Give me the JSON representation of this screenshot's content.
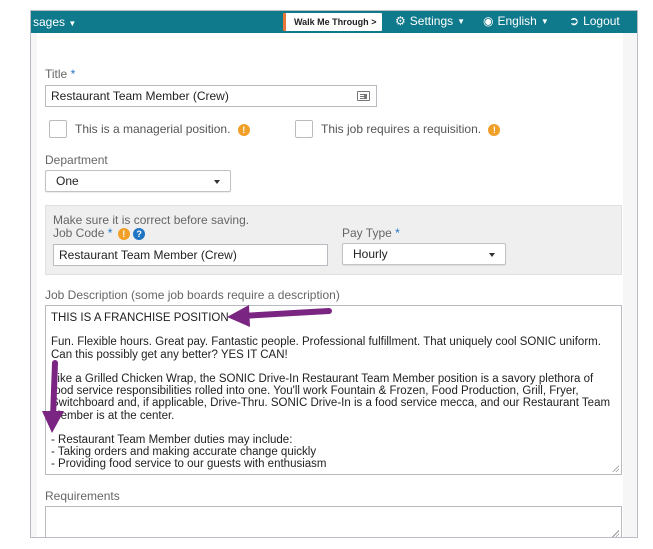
{
  "topbar": {
    "messages_label": "sages",
    "walk_label": "Walk Me Through",
    "walk_chevron": ">",
    "settings_label": "Settings",
    "language_label": "English",
    "logout_label": "Logout"
  },
  "form": {
    "title": {
      "label": "Title",
      "required_mark": "*",
      "value": "Restaurant Team Member (Crew)"
    },
    "managerial": {
      "label": "This is a managerial position.",
      "checked": false
    },
    "requisition": {
      "label": "This job requires a requisition.",
      "checked": false
    },
    "department": {
      "label": "Department",
      "selected": "One"
    },
    "panel": {
      "note": "Make sure it is correct before saving.",
      "job_code_label": "Job Code",
      "job_code_required": "*",
      "job_code_value": "Restaurant Team Member (Crew)",
      "pay_type_label": "Pay Type",
      "pay_type_required": "*",
      "pay_type_selected": "Hourly"
    },
    "job_description": {
      "label": "Job Description (some job boards require a description)",
      "lines": [
        "THIS IS A FRANCHISE POSITION",
        "",
        "Fun. Flexible hours. Great pay. Fantastic people. Professional fulfillment. That uniquely cool SONIC uniform.",
        "Can this possibly get any better? YES IT CAN!",
        "",
        "Like a Grilled Chicken Wrap, the SONIC Drive-In Restaurant Team Member position is a savory plethora of",
        "food service responsibilities rolled into one. You'll work Fountain & Frozen, Food Production, Grill, Fryer,",
        "Switchboard and, if applicable, Drive-Thru. SONIC Drive-In is a food service mecca, and our Restaurant Team",
        "Member is at the center.",
        "",
        "- Restaurant Team Member duties may include:",
        "- Taking orders and making accurate change quickly",
        "- Providing food service to our guests with enthusiasm"
      ]
    },
    "requirements": {
      "label": "Requirements",
      "value": ""
    }
  },
  "colors": {
    "topbar": "#0f7a8c",
    "arrow": "#7b2583",
    "required": "#1f74c4",
    "info": "#f0a028"
  }
}
